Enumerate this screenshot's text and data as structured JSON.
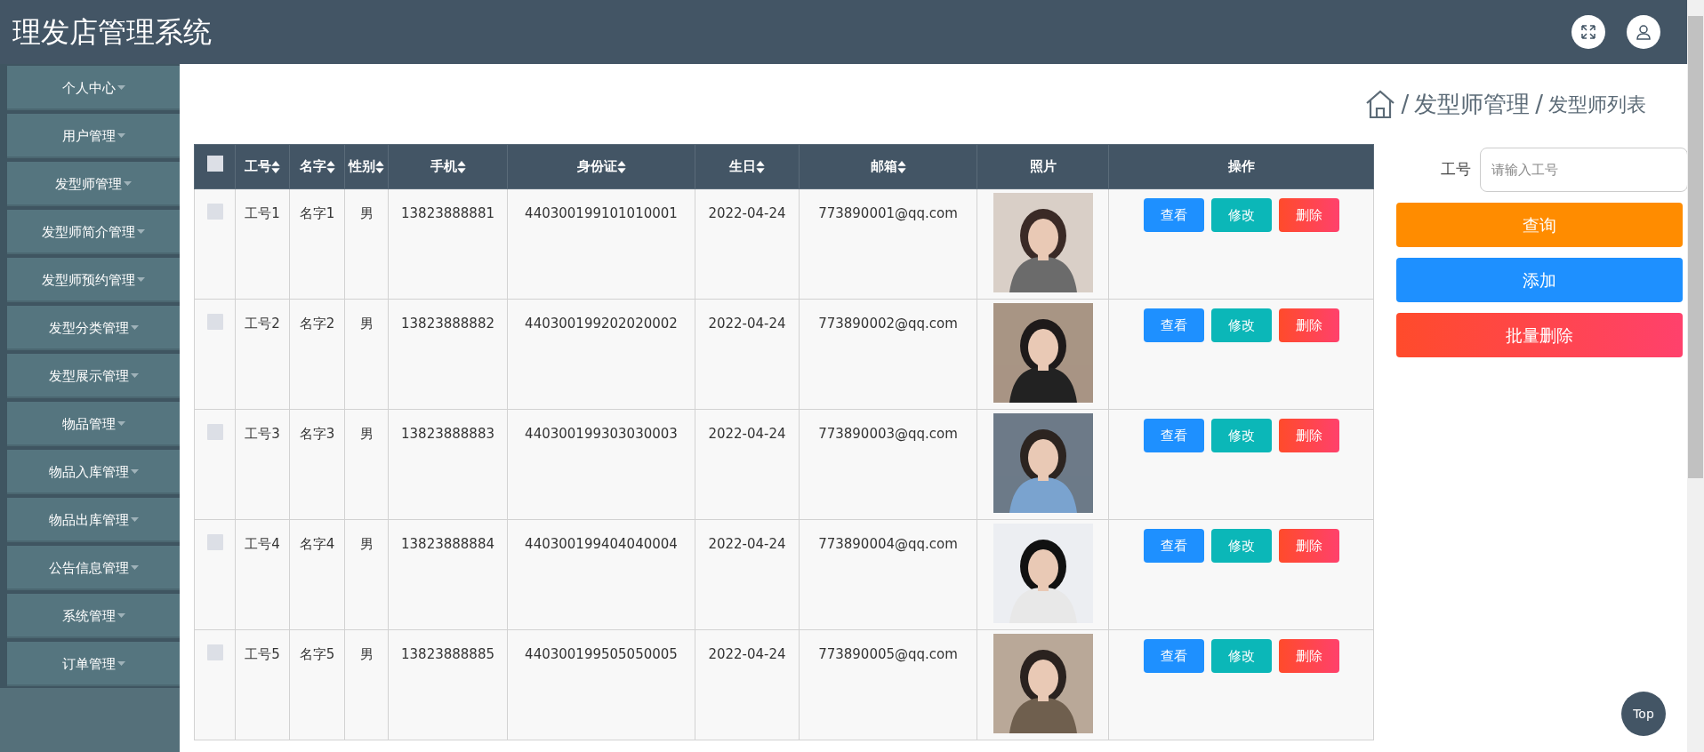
{
  "header": {
    "title": "理发店管理系统"
  },
  "sidebar": {
    "items": [
      {
        "label": "个人中心"
      },
      {
        "label": "用户管理"
      },
      {
        "label": "发型师管理"
      },
      {
        "label": "发型师简介管理"
      },
      {
        "label": "发型师预约管理"
      },
      {
        "label": "发型分类管理"
      },
      {
        "label": "发型展示管理"
      },
      {
        "label": "物品管理"
      },
      {
        "label": "物品入库管理"
      },
      {
        "label": "物品出库管理"
      },
      {
        "label": "公告信息管理"
      },
      {
        "label": "系统管理"
      },
      {
        "label": "订单管理"
      }
    ]
  },
  "breadcrumb": [
    {
      "separator": "/",
      "label": "发型师管理"
    },
    {
      "separator": "/",
      "label": "发型师列表"
    }
  ],
  "table": {
    "select_all": {
      "checked": false
    },
    "columns": [
      {
        "label": "工号",
        "sortable": true
      },
      {
        "label": "名字",
        "sortable": true
      },
      {
        "label": "性别",
        "sortable": true
      },
      {
        "label": "手机",
        "sortable": true
      },
      {
        "label": "身份证",
        "sortable": true
      },
      {
        "label": "生日",
        "sortable": true
      },
      {
        "label": "邮箱",
        "sortable": true
      },
      {
        "label": "照片",
        "sortable": false
      },
      {
        "label": "操作",
        "sortable": false
      }
    ],
    "rows": [
      {
        "checked": false,
        "cells": [
          "工号1",
          "名字1",
          "男",
          "13823888881",
          "440300199101010001",
          "2022-04-24",
          "773890001@qq.com"
        ],
        "actions": [
          "查看",
          "修改",
          "删除"
        ]
      },
      {
        "checked": false,
        "cells": [
          "工号2",
          "名字2",
          "男",
          "13823888882",
          "440300199202020002",
          "2022-04-24",
          "773890002@qq.com"
        ],
        "actions": [
          "查看",
          "修改",
          "删除"
        ]
      },
      {
        "checked": false,
        "cells": [
          "工号3",
          "名字3",
          "男",
          "13823888883",
          "440300199303030003",
          "2022-04-24",
          "773890003@qq.com"
        ],
        "actions": [
          "查看",
          "修改",
          "删除"
        ]
      },
      {
        "checked": false,
        "cells": [
          "工号4",
          "名字4",
          "男",
          "13823888884",
          "440300199404040004",
          "2022-04-24",
          "773890004@qq.com"
        ],
        "actions": [
          "查看",
          "修改",
          "删除"
        ]
      },
      {
        "checked": false,
        "cells": [
          "工号5",
          "名字5",
          "男",
          "13823888885",
          "440300199505050005",
          "2022-04-24",
          "773890005@qq.com"
        ],
        "actions": [
          "查看",
          "修改",
          "删除"
        ]
      }
    ]
  },
  "search": {
    "label": "工号",
    "placeholder": "请输入工号"
  },
  "buttons": [
    {
      "kind": "query",
      "label": "查询"
    },
    {
      "kind": "add",
      "label": "添加"
    },
    {
      "kind": "batch_delete",
      "label": "批量删除"
    }
  ],
  "top_button": {
    "label": "Top"
  }
}
